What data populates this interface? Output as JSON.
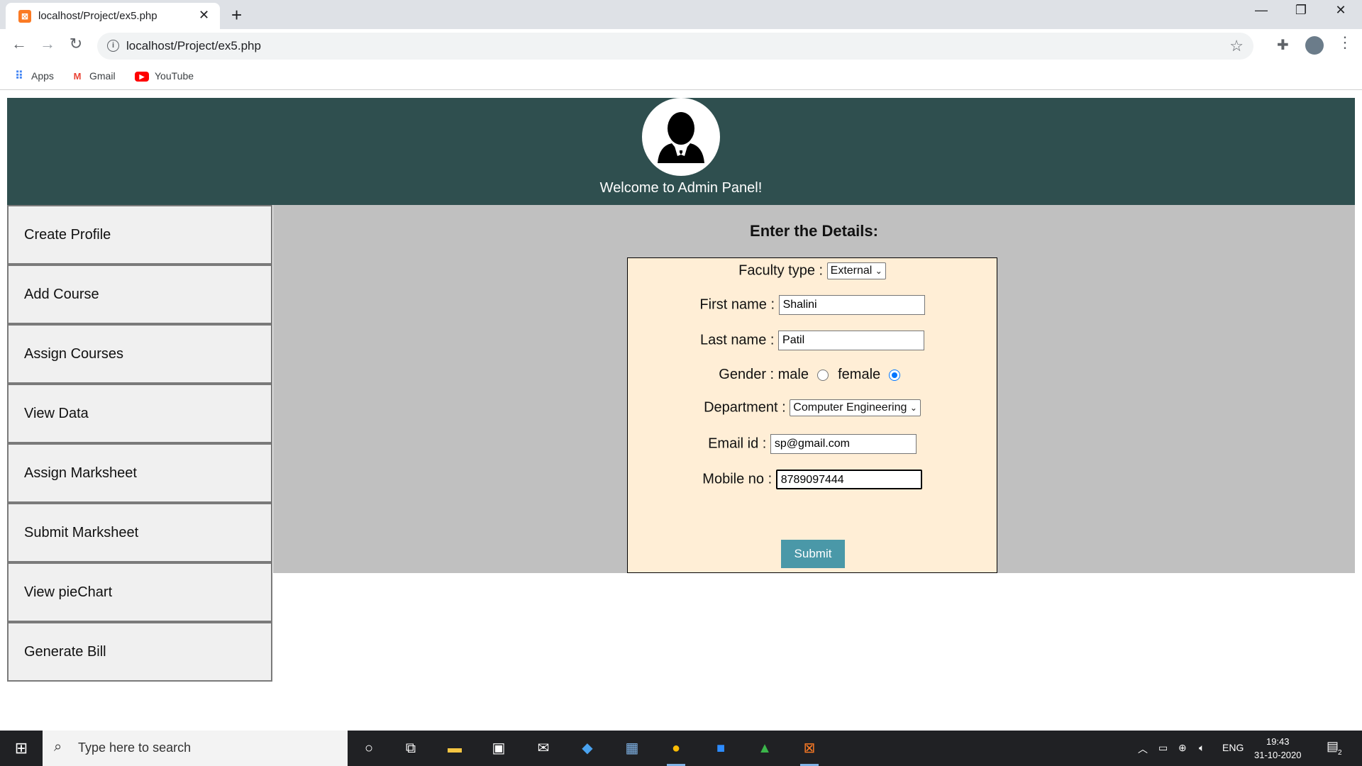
{
  "browser": {
    "tab_title": "localhost/Project/ex5.php",
    "url": "localhost/Project/ex5.php",
    "bookmarks": [
      {
        "label": "Apps",
        "icon": "apps-grid-icon"
      },
      {
        "label": "Gmail",
        "icon": "gmail-icon"
      },
      {
        "label": "YouTube",
        "icon": "youtube-icon"
      }
    ]
  },
  "header": {
    "welcome": "Welcome to Admin Panel!"
  },
  "sidebar": {
    "items": [
      {
        "label": "Create Profile"
      },
      {
        "label": "Add Course"
      },
      {
        "label": "Assign Courses"
      },
      {
        "label": "View Data"
      },
      {
        "label": "Assign Marksheet"
      },
      {
        "label": "Submit Marksheet"
      },
      {
        "label": "View pieChart"
      },
      {
        "label": "Generate Bill"
      }
    ]
  },
  "form": {
    "title": "Enter the Details:",
    "faculty_type_label": "Faculty type :",
    "faculty_type_value": "External",
    "first_name_label": "First name :",
    "first_name_value": "Shalini",
    "last_name_label": "Last name :",
    "last_name_value": "Patil",
    "gender_label": "Gender : male",
    "gender_female_label": "female",
    "gender_selected": "female",
    "department_label": "Department :",
    "department_value": "Computer Engineering",
    "email_label": "Email id :",
    "email_value": "sp@gmail.com",
    "mobile_label": "Mobile no :",
    "mobile_value": "8789097444",
    "submit_label": "Submit"
  },
  "taskbar": {
    "search_placeholder": "Type here to search",
    "language": "ENG",
    "time": "19:43",
    "date": "31-10-2020",
    "notification_count": "2"
  },
  "colors": {
    "header_bg": "#2f4f4f",
    "content_bg": "#c0c0c0",
    "form_bg": "#ffeed6",
    "submit_bg": "#4a98a8",
    "sidebar_bg": "#f0f0f0"
  }
}
